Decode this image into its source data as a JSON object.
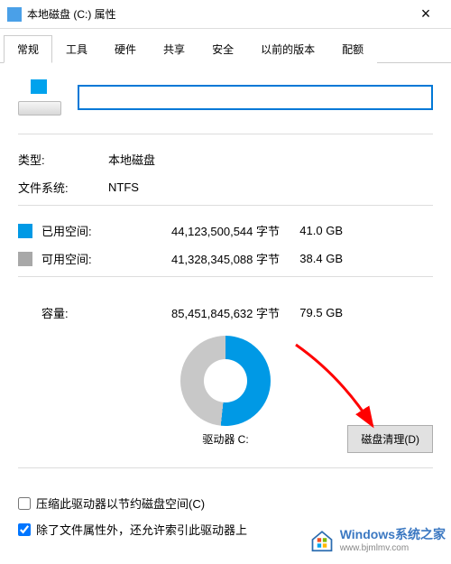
{
  "window": {
    "title": "本地磁盘 (C:) 属性",
    "close_glyph": "×"
  },
  "tabs": {
    "general": "常规",
    "tools": "工具",
    "hardware": "硬件",
    "sharing": "共享",
    "security": "安全",
    "previous": "以前的版本",
    "quota": "配额"
  },
  "props": {
    "type_label": "类型:",
    "type_value": "本地磁盘",
    "fs_label": "文件系统:",
    "fs_value": "NTFS"
  },
  "space": {
    "used_label": "已用空间:",
    "used_bytes": "44,123,500,544 字节",
    "used_gb": "41.0 GB",
    "free_label": "可用空间:",
    "free_bytes": "41,328,345,088 字节",
    "free_gb": "38.4 GB",
    "cap_label": "容量:",
    "cap_bytes": "85,451,845,632 字节",
    "cap_gb": "79.5 GB"
  },
  "drive_label": "驱动器 C:",
  "cleanup_btn": "磁盘清理(D)",
  "checks": {
    "compress": "压缩此驱动器以节约磁盘空间(C)",
    "index": "除了文件属性外，还允许索引此驱动器上"
  },
  "watermark": {
    "brand": "Windows系统之家",
    "url": "www.bjmlmv.com"
  },
  "chart_data": {
    "type": "pie",
    "title": "驱动器 C:",
    "series": [
      {
        "name": "已用空间",
        "value_bytes": 44123500544,
        "value_gb": 41.0,
        "color": "#0099e5"
      },
      {
        "name": "可用空间",
        "value_bytes": 41328345088,
        "value_gb": 38.4,
        "color": "#c8c8c8"
      }
    ],
    "total_bytes": 85451845632,
    "total_gb": 79.5
  },
  "colors": {
    "used": "#0099e5",
    "free": "#a8a8a8",
    "accent": "#0078d7"
  }
}
